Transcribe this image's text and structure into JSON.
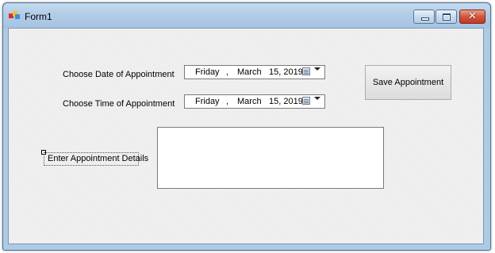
{
  "window": {
    "title": "Form1",
    "icon": "winforms-app-icon",
    "controls": {
      "minimize": "minimize-icon",
      "maximize": "maximize-icon",
      "close_glyph": "✕"
    }
  },
  "form": {
    "date_label": "Choose Date of Appointment",
    "time_label": "Choose Time of Appointment",
    "date_picker": {
      "day": "Friday",
      "sep": ",",
      "month": "March",
      "date": "15, 2019"
    },
    "time_picker": {
      "day": "Friday",
      "sep": ",",
      "month": "March",
      "date": "15, 2019"
    },
    "save_button": "Save Appointment",
    "details_label": "Enter Appointment Details",
    "details_value": ""
  },
  "colors": {
    "close_button": "#c23a22",
    "form_background": "#f0f0f0",
    "window_frame": "#aecbe6"
  }
}
